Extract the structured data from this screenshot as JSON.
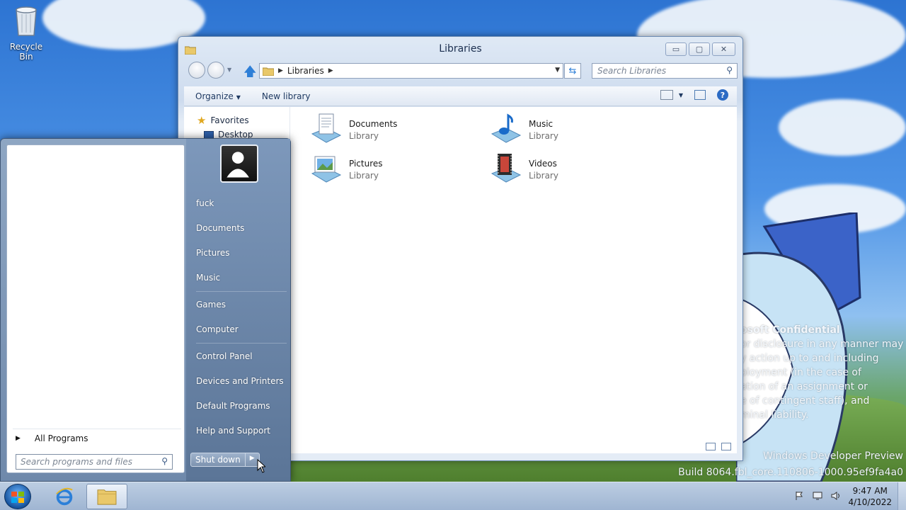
{
  "desktop": {
    "recycle_bin_label": "Recycle Bin",
    "watermark_title": "osoft Confidential",
    "watermark_lines": [
      "or disclosure in any manner may",
      "y action up to and including",
      "ployment (in the case of",
      "ation of an assignment or",
      "e of contingent staff), and",
      "minal liability."
    ],
    "build_line1": "Windows Developer Preview",
    "build_line2": "Build 8064.fbl_core.110806-1000.95ef9fa4a0"
  },
  "explorer": {
    "title": "Libraries",
    "address": {
      "crumbs": [
        "Libraries"
      ]
    },
    "search_placeholder": "Search Libraries",
    "commands": {
      "organize": "Organize",
      "new_library": "New library"
    },
    "nav": {
      "favorites": "Favorites",
      "desktop": "Desktop"
    },
    "libraries": [
      {
        "name": "Documents",
        "type": "Library"
      },
      {
        "name": "Music",
        "type": "Library"
      },
      {
        "name": "Pictures",
        "type": "Library"
      },
      {
        "name": "Videos",
        "type": "Library"
      }
    ]
  },
  "start_menu": {
    "all_programs": "All Programs",
    "search_placeholder": "Search programs and files",
    "user_name": "fuck",
    "links": [
      "Documents",
      "Pictures",
      "Music",
      "Games",
      "Computer",
      "Control Panel",
      "Devices and Printers",
      "Default Programs",
      "Help and Support"
    ],
    "shutdown_label": "Shut down"
  },
  "taskbar": {
    "clock_time": "9:47 AM",
    "clock_date": "4/10/2022"
  },
  "colors": {
    "accent": "#2c6bc4",
    "start_panel": "#6f89ab",
    "taskbar": "#9fb5d2"
  }
}
